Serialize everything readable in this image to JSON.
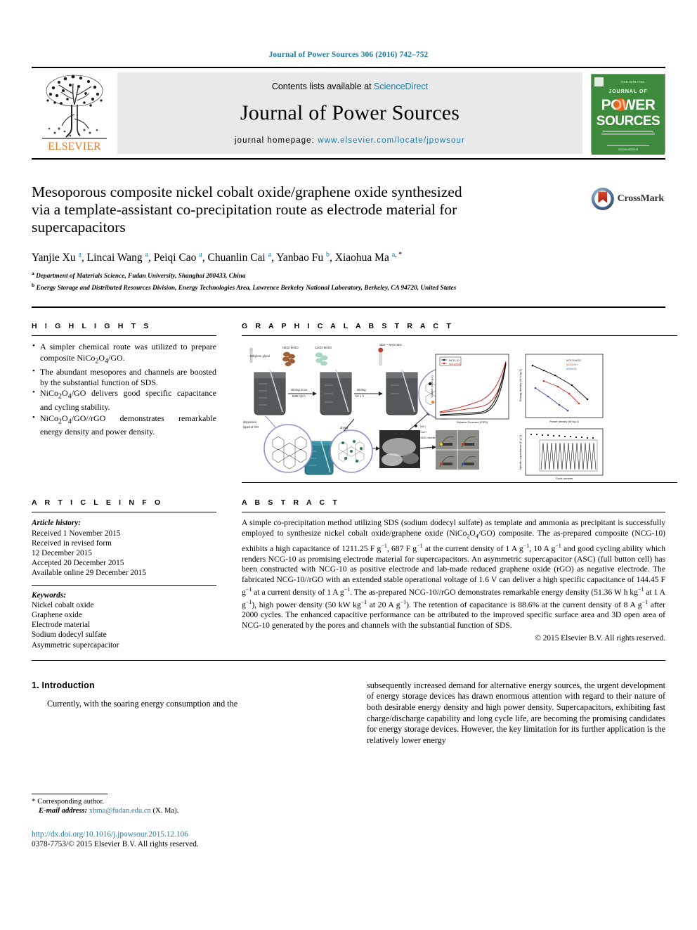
{
  "running_head": "Journal of Power Sources 306 (2016) 742–752",
  "masthead": {
    "publisher_word": "ELSEVIER",
    "contents_prefix": "Contents lists available at",
    "contents_link": "ScienceDirect",
    "journal_name": "Journal of Power Sources",
    "homepage_label": "journal homepage:",
    "homepage_url": "www.elsevier.com/locate/jpowsour",
    "cover": {
      "top_label": "JOURNAL OF",
      "title_line1": "POWER",
      "title_line2": "SOURCES",
      "blurb": "An international journal on the Science and Technology of Electrochemical Energy Conversion and Storage Devices",
      "footer": "Available online at ScienceDirect"
    }
  },
  "article": {
    "title": "Mesoporous composite nickel cobalt oxide/graphene oxide synthesized via a template-assistant co-precipitation route as electrode material for supercapacitors",
    "crossmark_label": "CrossMark",
    "authors": [
      {
        "name": "Yanjie Xu",
        "marks": "a"
      },
      {
        "name": "Lincai Wang",
        "marks": "a"
      },
      {
        "name": "Peiqi Cao",
        "marks": "a"
      },
      {
        "name": "Chuanlin Cai",
        "marks": "a"
      },
      {
        "name": "Yanbao Fu",
        "marks": "b"
      },
      {
        "name": "Xiaohua Ma",
        "marks": "a, *"
      }
    ],
    "affiliations": [
      {
        "mark": "a",
        "text": "Department of Materials Science, Fudan University, Shanghai 200433, China"
      },
      {
        "mark": "b",
        "text": "Energy Storage and Distributed Resources Division, Energy Technologies Area, Lawrence Berkeley National Laboratory, Berkeley, CA 94720, United States"
      }
    ]
  },
  "highlights": {
    "heading": "H I G H L I G H T S",
    "items": [
      "A simpler chemical route was utilized to prepare composite NiCo2O4/GO.",
      "The abundant mesopores and channels are boosted by the substantial function of SDS.",
      "NiCo2O4/GO delivers good specific capacitance and cycling stability.",
      "NiCo2O4/GO//rGO demonstrates remarkable energy density and power density."
    ]
  },
  "graphical_abstract": {
    "heading": "G R A P H I C A L   A B S T R A C T"
  },
  "article_info": {
    "heading": "A R T I C L E   I N F O",
    "history_label": "Article history:",
    "history": [
      "Received 1 November 2015",
      "Received in revised form",
      "12 December 2015",
      "Accepted 20 December 2015",
      "Available online 29 December 2015"
    ],
    "keywords_label": "Keywords:",
    "keywords": [
      "Nickel cobalt oxide",
      "Graphene oxide",
      "Electrode material",
      "Sodium dodecyl sulfate",
      "Asymmetric supercapacitor"
    ]
  },
  "abstract": {
    "heading": "A B S T R A C T",
    "paragraphs": [
      "A simple co-precipitation method utilizing SDS (sodium dodecyl sulfate) as template and ammonia as precipitant is successfully employed to synthesize nickel cobalt oxide/graphene oxide (NiCo2O4/GO) composite. The as-prepared composite (NCG-10) exhibits a high capacitance of 1211.25 F g-1, 687 F g-1 at the current density of 1 A g-1, 10 A g-1 and good cycling ability which renders NCG-10 as promising electrode material for supercapacitors. An asymmetric supercapacitor (ASC) (full button cell) has been constructed with NCG-10 as positive electrode and lab-made reduced graphene oxide (rGO) as negative electrode. The fabricated NCG-10//rGO with an extended stable operational voltage of 1.6 V can deliver a high specific capacitance of 144.45 F g-1 at a current density of 1 A g-1. The as-prepared NCG-10//rGO demonstrates remarkable energy density (51.36 W h kg-1 at 1 A g-1), high power density (50 kW kg-1 at 20 A g-1). The retention of capacitance is 88.6% at the current density of 8 A g-1 after 2000 cycles. The enhanced capacitive performance can be attributed to the improved specific surface area and 3D open area of NCG-10 generated by the pores and channels with the substantial function of SDS."
    ],
    "copyright": "© 2015 Elsevier B.V. All rights reserved."
  },
  "body": {
    "section_heading": "1. Introduction",
    "left_paragraph": "Currently, with the soaring energy consumption and the",
    "right_paragraph": "subsequently increased demand for alternative energy sources, the urgent development of energy storage devices has drawn enormous attention with regard to their nature of both desirable energy density and high power density. Supercapacitors, exhibiting fast charge/discharge capability and long cycle life, are becoming the promising candidates for energy storage devices. However, the key limitation for its further application is the relatively lower energy"
  },
  "footnote": {
    "corresponding_marker": "*",
    "corresponding_label": "Corresponding author.",
    "email_label": "E-mail address:",
    "email": "xhma@fudan.edu.cn",
    "email_suffix": "(X. Ma).",
    "doi": "http://dx.doi.org/10.1016/j.jpowsour.2015.12.106",
    "issn_line": "0378-7753/© 2015 Elsevier B.V. All rights reserved."
  },
  "colors": {
    "link": "#1a7aa8",
    "elsevier_orange": "#e87722",
    "cover_green": "#3e8b3e",
    "band_gray": "#e9e9e9"
  }
}
